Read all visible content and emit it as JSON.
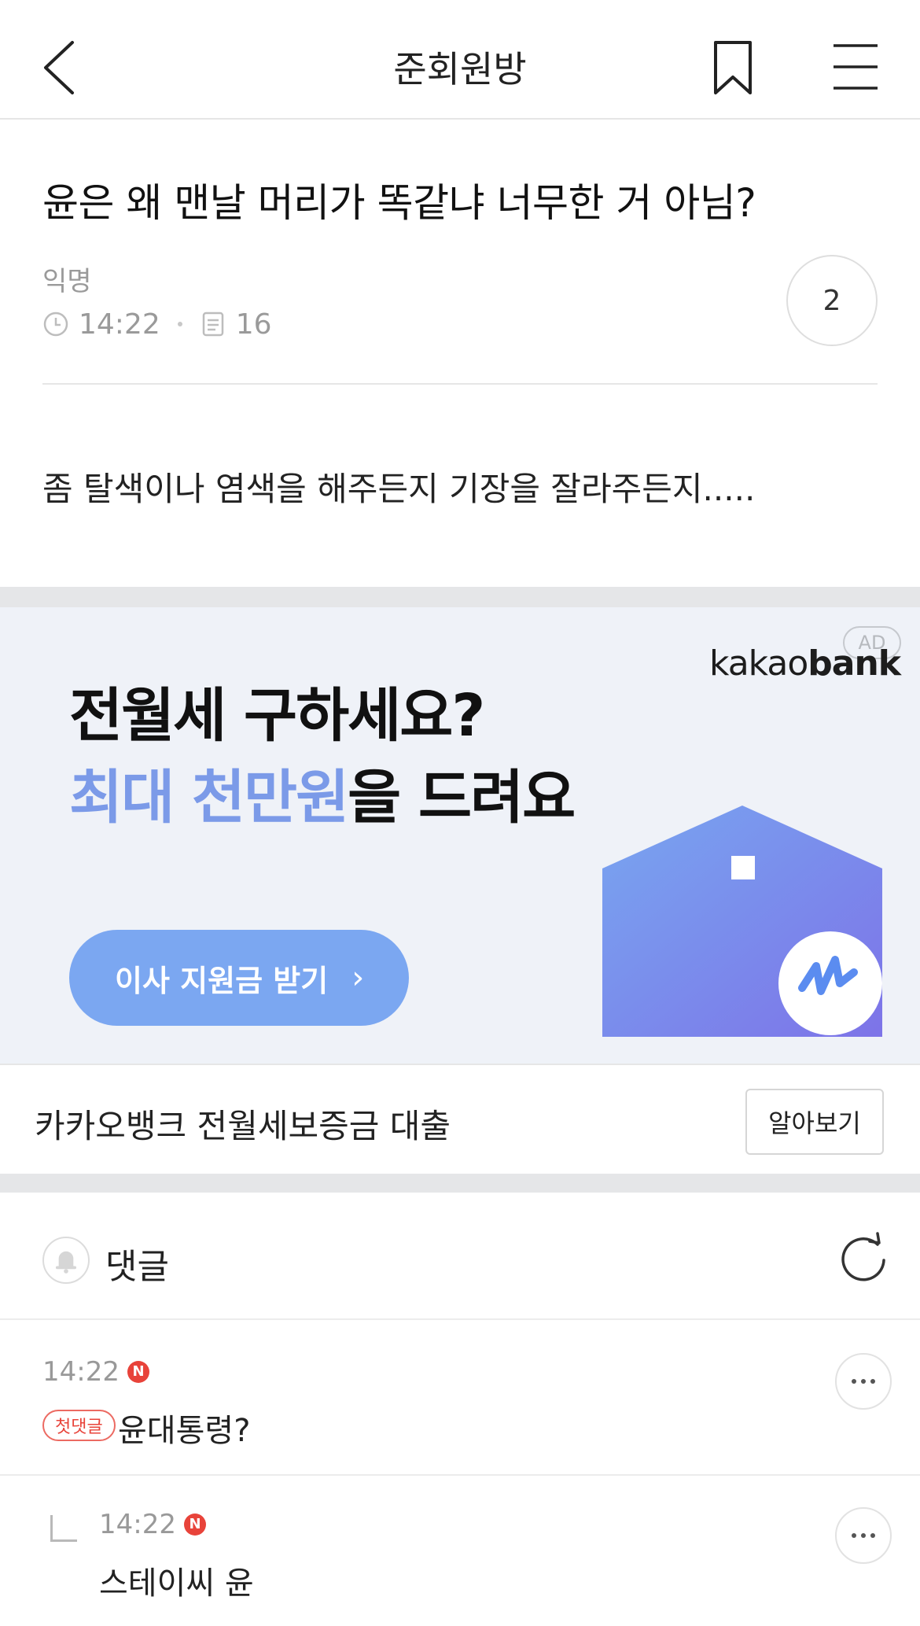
{
  "header": {
    "title": "준회원방"
  },
  "post": {
    "title": "윤은 왜 맨날 머리가 똑같냐 너무한 거 아님?",
    "author": "익명",
    "time": "14:22",
    "views": "16",
    "comment_count": "2",
    "body": "좀 탈색이나 염색을 해주든지 기장을 잘라주든지....."
  },
  "ad": {
    "badge": "AD",
    "brand_light": "kakao",
    "brand_bold": "bank",
    "line1": "전월세 구하세요?",
    "line2_highlight": "최대 천만원",
    "line2_rest": "을 드려요",
    "cta": "이사 지원금 받기",
    "cta_chevron": "›",
    "footer_text": "카카오뱅크 전월세보증금 대출",
    "footer_button": "알아보기"
  },
  "comments": {
    "label": "댓글",
    "items": [
      {
        "time": "14:22",
        "new_badge": "N",
        "first_badge": "첫댓글",
        "text": "윤대통령?"
      },
      {
        "time": "14:22",
        "new_badge": "N",
        "text": "스테이씨 윤"
      }
    ]
  },
  "colors": {
    "ad_background": "#eff2f8",
    "ad_highlight": "#7b9ae8",
    "ad_cta": "#7ba7f1",
    "new_badge": "#e8433a"
  },
  "icons": [
    "back-arrow-icon",
    "bookmark-icon",
    "hamburger-menu-icon",
    "clock-icon",
    "views-icon",
    "bell-icon",
    "refresh-icon",
    "more-options-icon",
    "reply-arrow-icon"
  ]
}
